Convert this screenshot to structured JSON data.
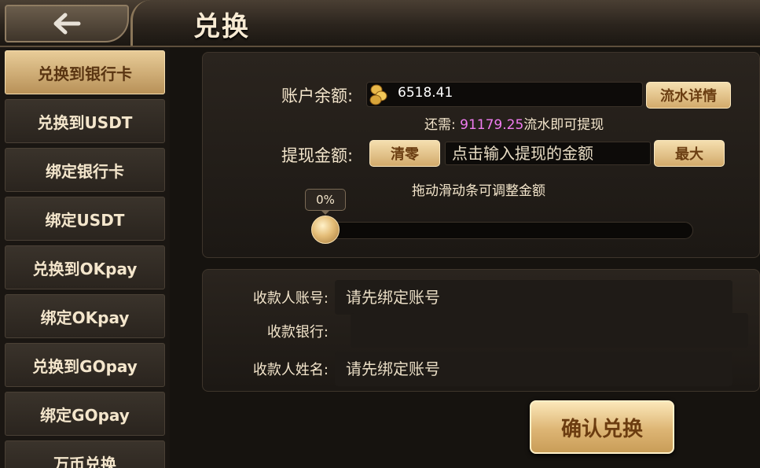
{
  "header": {
    "title": "兑换"
  },
  "sidebar": {
    "items": [
      {
        "label": "兑换到银行卡",
        "active": true
      },
      {
        "label": "兑换到USDT"
      },
      {
        "label": "绑定银行卡"
      },
      {
        "label": "绑定USDT"
      },
      {
        "label": "兑换到OKpay"
      },
      {
        "label": "绑定OKpay"
      },
      {
        "label": "兑换到GOpay"
      },
      {
        "label": "绑定GOpay"
      },
      {
        "label": "万币兑换"
      }
    ]
  },
  "withdraw": {
    "balance_label": "账户余额:",
    "balance_value": "6518.41",
    "flow_detail_button": "流水详情",
    "need_prefix": "还需:",
    "need_value": "91179.25",
    "need_suffix": "流水即可提现",
    "amount_label": "提现金额:",
    "clear_button": "清零",
    "amount_placeholder": "点击输入提现的金额",
    "max_button": "最大",
    "slider_hint": "拖动滑动条可调整金额",
    "slider_percent": "0%",
    "slider_value": 0
  },
  "recipient": {
    "account_label": "收款人账号:",
    "account_value": "请先绑定账号",
    "bank_label": "收款银行:",
    "bank_value": "",
    "name_label": "收款人姓名:",
    "name_value": "请先绑定账号"
  },
  "confirm_button": "确认兑换",
  "colors": {
    "gold": "#e0bb7c",
    "accent_pink": "#f07cf0",
    "bg": "#16130f"
  },
  "icons": {
    "back": "back-arrow-icon",
    "coin": "gold-coin-icon"
  }
}
